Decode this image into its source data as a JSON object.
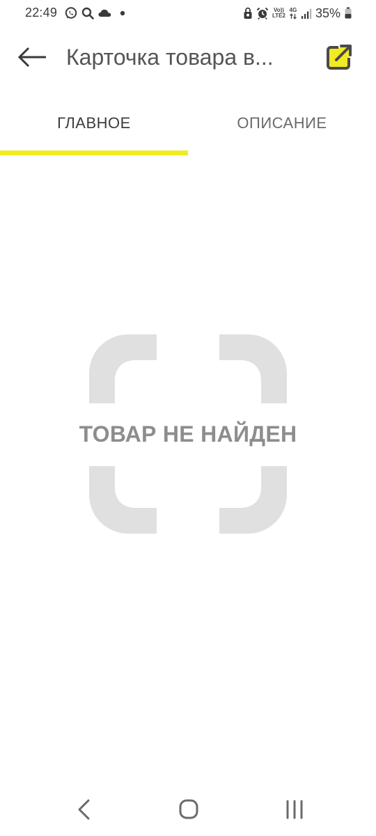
{
  "status_bar": {
    "time": "22:49",
    "battery_percent": "35%",
    "volte_top": "Vo))",
    "volte_bottom": "LTE2",
    "network_type": "4G",
    "left_icons": [
      "whatsapp-icon",
      "search-icon",
      "cloud-icon",
      "dot-icon"
    ],
    "right_icons": [
      "lock-icon",
      "alarm-icon",
      "volte-icon",
      "4g-icon",
      "signal-icon",
      "battery-icon"
    ]
  },
  "app_bar": {
    "title": "Карточка товара в...",
    "back_icon": "arrow-left-icon",
    "action_icon": "open-external-icon"
  },
  "tabs": [
    {
      "label": "ГЛАВНОЕ",
      "active": true
    },
    {
      "label": "ОПИСАНИЕ",
      "active": false
    }
  ],
  "content": {
    "message": "ТОВАР НЕ НАЙДЕН"
  },
  "nav_bar": {
    "icons": [
      "nav-back-icon",
      "nav-home-icon",
      "nav-recent-icon"
    ]
  },
  "colors": {
    "accent": "#f2ea22",
    "title": "#555555",
    "placeholder_frame": "#e0e0e0",
    "placeholder_text": "#8d8d8d"
  }
}
